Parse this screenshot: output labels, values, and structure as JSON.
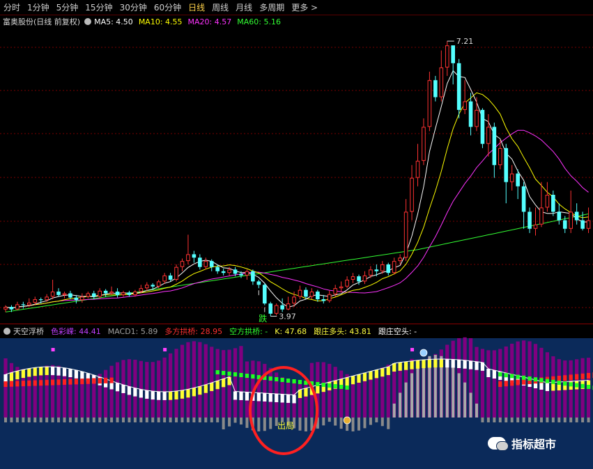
{
  "toolbar": {
    "tabs": [
      "分时",
      "1分钟",
      "5分钟",
      "15分钟",
      "30分钟",
      "60分钟",
      "日线",
      "周线",
      "月线",
      "多周期",
      "更多 >"
    ],
    "active_tab": "日线"
  },
  "main_panel": {
    "title": "富奥股份(日线 前复权)",
    "ma": [
      {
        "label": "MA5: 4.50",
        "color": "#ffffff"
      },
      {
        "label": "MA10: 4.55",
        "color": "#ffff00"
      },
      {
        "label": "MA20: 4.57",
        "color": "#ff33ff"
      },
      {
        "label": "MA60: 5.16",
        "color": "#33ff33"
      }
    ],
    "high_label": "7.21",
    "low_label": "3.97",
    "signal_label": "跌"
  },
  "indicator_panel": {
    "name": "天空浮桥",
    "items": [
      {
        "label": "色彩嵘: 44.41",
        "color": "#c040ff"
      },
      {
        "label": "MACD1: 5.89",
        "color": "#a0a0a0"
      },
      {
        "label": "多方拱桥: 28.95",
        "color": "#ff3030"
      },
      {
        "label": "空方拱桥: -",
        "color": "#30ff30"
      },
      {
        "label": "K: 47.68",
        "color": "#ffff40"
      },
      {
        "label": "跟庄多头: 43.81",
        "color": "#ffff40"
      },
      {
        "label": "跟庄空头: -",
        "color": "#ffffff"
      }
    ],
    "marker_label": "出局"
  },
  "watermark": "指标超市",
  "colors": {
    "up": "#ff3232",
    "down": "#54ffff",
    "ma5": "#ffffff",
    "ma10": "#ffff00",
    "ma20": "#ff33ff",
    "ma60": "#33ff33",
    "subpanel_bg": "#0b2a5a",
    "purple_bar": "#800080",
    "annotation_circle": "#ff2020"
  },
  "candles": [
    [
      4.05,
      4.08,
      4.02,
      4.1
    ],
    [
      4.08,
      4.05,
      4.02,
      4.1
    ],
    [
      4.05,
      4.11,
      4.04,
      4.14
    ],
    [
      4.11,
      4.1,
      4.06,
      4.14
    ],
    [
      4.1,
      4.13,
      4.08,
      4.18
    ],
    [
      4.13,
      4.17,
      4.1,
      4.2
    ],
    [
      4.17,
      4.16,
      4.12,
      4.19
    ],
    [
      4.16,
      4.2,
      4.14,
      4.23
    ],
    [
      4.2,
      4.26,
      4.17,
      4.4
    ],
    [
      4.26,
      4.22,
      4.2,
      4.3
    ],
    [
      4.22,
      4.24,
      4.18,
      4.26
    ],
    [
      4.24,
      4.19,
      4.17,
      4.27
    ],
    [
      4.19,
      4.16,
      4.12,
      4.22
    ],
    [
      4.16,
      4.2,
      4.13,
      4.24
    ],
    [
      4.2,
      4.24,
      4.18,
      4.26
    ],
    [
      4.24,
      4.2,
      4.17,
      4.27
    ],
    [
      4.2,
      4.27,
      4.18,
      4.3
    ],
    [
      4.27,
      4.24,
      4.2,
      4.29
    ],
    [
      4.24,
      4.26,
      4.22,
      4.32
    ],
    [
      4.26,
      4.22,
      4.19,
      4.3
    ],
    [
      4.22,
      4.25,
      4.2,
      4.27
    ],
    [
      4.25,
      4.22,
      4.2,
      4.27
    ],
    [
      4.22,
      4.26,
      4.2,
      4.28
    ],
    [
      4.26,
      4.3,
      4.24,
      4.34
    ],
    [
      4.3,
      4.34,
      4.27,
      4.37
    ],
    [
      4.34,
      4.32,
      4.28,
      4.36
    ],
    [
      4.32,
      4.38,
      4.3,
      4.4
    ],
    [
      4.38,
      4.45,
      4.35,
      4.48
    ],
    [
      4.45,
      4.4,
      4.38,
      4.48
    ],
    [
      4.4,
      4.55,
      4.38,
      4.58
    ],
    [
      4.55,
      4.62,
      4.5,
      4.65
    ],
    [
      4.62,
      4.7,
      4.58,
      4.93
    ],
    [
      4.7,
      4.66,
      4.6,
      4.74
    ],
    [
      4.66,
      4.55,
      4.52,
      4.7
    ],
    [
      4.55,
      4.62,
      4.52,
      4.66
    ],
    [
      4.62,
      4.55,
      4.5,
      4.64
    ],
    [
      4.55,
      4.5,
      4.47,
      4.58
    ],
    [
      4.5,
      4.48,
      4.45,
      4.53
    ],
    [
      4.48,
      4.52,
      4.45,
      4.55
    ],
    [
      4.52,
      4.47,
      4.44,
      4.55
    ],
    [
      4.47,
      4.45,
      4.42,
      4.5
    ],
    [
      4.45,
      4.5,
      4.4,
      4.52
    ],
    [
      4.5,
      4.38,
      4.34,
      4.52
    ],
    [
      4.38,
      4.34,
      4.3,
      4.4
    ],
    [
      4.34,
      4.12,
      4.1,
      4.36
    ],
    [
      4.12,
      4.0,
      3.97,
      4.14
    ],
    [
      4.0,
      4.1,
      3.98,
      4.12
    ],
    [
      4.1,
      4.05,
      4.02,
      4.18
    ],
    [
      4.05,
      4.12,
      4.04,
      4.2
    ],
    [
      4.12,
      4.2,
      4.08,
      4.26
    ],
    [
      4.2,
      4.28,
      4.17,
      4.33
    ],
    [
      4.28,
      4.2,
      4.17,
      4.31
    ],
    [
      4.2,
      4.26,
      4.17,
      4.3
    ],
    [
      4.26,
      4.17,
      4.14,
      4.28
    ],
    [
      4.17,
      4.15,
      4.12,
      4.22
    ],
    [
      4.15,
      4.23,
      4.13,
      4.27
    ],
    [
      4.23,
      4.3,
      4.2,
      4.34
    ],
    [
      4.3,
      4.32,
      4.25,
      4.38
    ],
    [
      4.32,
      4.4,
      4.3,
      4.44
    ],
    [
      4.4,
      4.44,
      4.36,
      4.48
    ],
    [
      4.44,
      4.38,
      4.34,
      4.46
    ],
    [
      4.38,
      4.45,
      4.35,
      4.5
    ],
    [
      4.45,
      4.52,
      4.42,
      4.56
    ],
    [
      4.52,
      4.5,
      4.44,
      4.58
    ],
    [
      4.5,
      4.58,
      4.47,
      4.62
    ],
    [
      4.58,
      4.48,
      4.45,
      4.6
    ],
    [
      4.48,
      4.62,
      4.46,
      4.66
    ],
    [
      4.62,
      4.66,
      4.58,
      4.7
    ],
    [
      4.66,
      5.2,
      4.62,
      5.35
    ],
    [
      5.2,
      5.6,
      5.1,
      5.75
    ],
    [
      5.6,
      5.8,
      5.5,
      6.0
    ],
    [
      5.8,
      6.2,
      5.75,
      6.3
    ],
    [
      6.2,
      6.75,
      6.15,
      6.85
    ],
    [
      6.75,
      6.55,
      6.5,
      6.8
    ],
    [
      6.55,
      6.9,
      6.5,
      7.1
    ],
    [
      6.9,
      7.16,
      6.8,
      7.21
    ],
    [
      7.16,
      6.95,
      6.7,
      7.05
    ],
    [
      6.95,
      6.4,
      6.3,
      7.0
    ],
    [
      6.4,
      6.5,
      6.35,
      6.75
    ],
    [
      6.5,
      6.2,
      6.1,
      6.6
    ],
    [
      6.2,
      6.4,
      6.15,
      6.55
    ],
    [
      6.4,
      6.0,
      5.95,
      6.42
    ],
    [
      6.0,
      6.2,
      5.85,
      6.35
    ],
    [
      6.2,
      5.75,
      5.6,
      6.25
    ],
    [
      5.75,
      5.95,
      5.7,
      6.05
    ],
    [
      5.95,
      5.55,
      5.3,
      6.0
    ],
    [
      5.55,
      5.65,
      5.45,
      5.75
    ],
    [
      5.65,
      5.5,
      5.35,
      5.7
    ],
    [
      5.5,
      5.2,
      5.0,
      5.55
    ],
    [
      5.2,
      5.0,
      4.95,
      5.25
    ],
    [
      5.0,
      5.05,
      4.92,
      5.25
    ],
    [
      5.05,
      5.25,
      5.02,
      5.55
    ],
    [
      5.25,
      5.4,
      5.2,
      5.55
    ],
    [
      5.4,
      5.2,
      5.15,
      5.45
    ],
    [
      5.2,
      5.1,
      5.05,
      5.3
    ],
    [
      5.1,
      5.0,
      4.95,
      5.15
    ],
    [
      5.0,
      5.2,
      4.95,
      5.45
    ],
    [
      5.2,
      5.1,
      5.05,
      5.3
    ],
    [
      5.1,
      5.0,
      4.98,
      5.2
    ],
    [
      5.0,
      5.1,
      4.95,
      5.25
    ]
  ]
}
